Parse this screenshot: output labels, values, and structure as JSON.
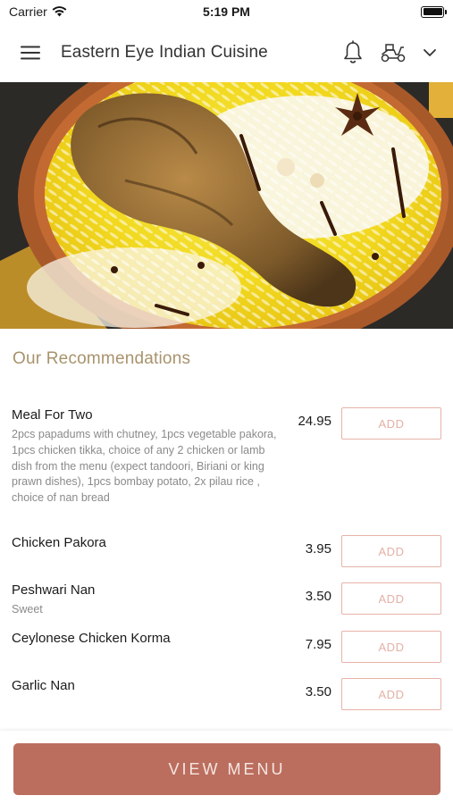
{
  "status_bar": {
    "carrier": "Carrier",
    "time": "5:19 PM"
  },
  "header": {
    "title": "Eastern Eye Indian Cuisine",
    "icons": [
      "menu-icon",
      "bell-icon",
      "scooter-icon",
      "chevron-down-icon"
    ]
  },
  "hero": {
    "icon": "biryani-food-photo"
  },
  "recommendations": {
    "title": "Our Recommendations",
    "add_label": "ADD",
    "items": [
      {
        "name": "Meal For Two",
        "description": "2pcs papadums with chutney, 1pcs vegetable pakora, 1pcs chicken tikka, choice of any 2 chicken or lamb dish from the menu (expect tandoori, Biriani or king prawn dishes), 1pcs bombay potato, 2x pilau rice , choice of nan bread",
        "price": "24.95"
      },
      {
        "name": "Chicken Pakora",
        "description": "",
        "price": "3.95"
      },
      {
        "name": "Peshwari Nan",
        "description": "Sweet",
        "price": "3.50"
      },
      {
        "name": "Ceylonese Chicken Korma",
        "description": "",
        "price": "7.95"
      },
      {
        "name": "Garlic Nan",
        "description": "",
        "price": "3.50"
      }
    ]
  },
  "footer": {
    "view_menu_label": "VIEW MENU"
  },
  "colors": {
    "accent": "#bb6e5e",
    "section_title": "#a8936c",
    "add_border": "#e6b3a8"
  }
}
